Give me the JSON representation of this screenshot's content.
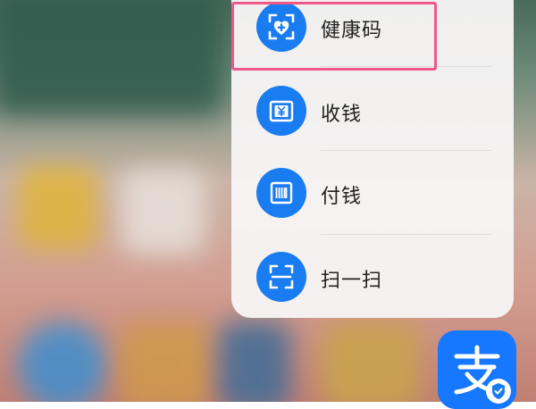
{
  "menu": {
    "items": [
      {
        "label": "健康码",
        "icon": "health-code-icon"
      },
      {
        "label": "收钱",
        "icon": "receive-money-icon"
      },
      {
        "label": "付钱",
        "icon": "pay-money-icon"
      },
      {
        "label": "扫一扫",
        "icon": "scan-icon"
      }
    ]
  },
  "app": {
    "glyph": "支",
    "icon": "alipay-app-icon"
  },
  "colors": {
    "accent": "#1a7cf1",
    "highlight": "#f0588a",
    "app_blue": "#1677ff"
  }
}
